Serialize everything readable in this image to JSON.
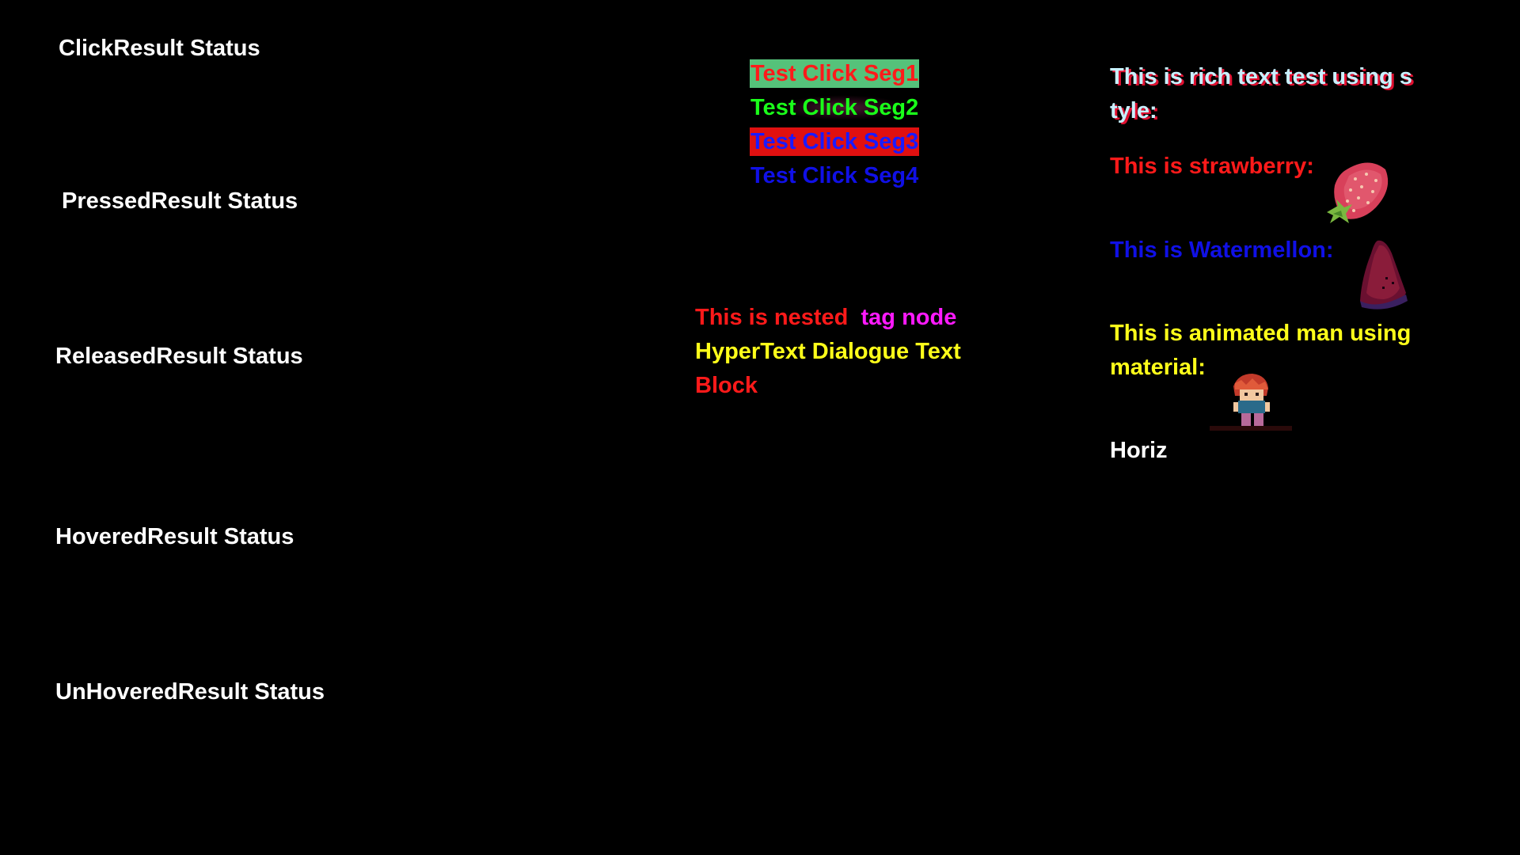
{
  "status": {
    "click": "ClickResult Status",
    "pressed": "PressedResult Status",
    "released": "ReleasedResult Status",
    "hovered": "HoveredResult Status",
    "unhovered": "UnHoveredResult Status"
  },
  "segments": [
    {
      "label": "Test Click Seg1",
      "color": "#ff1a1a",
      "background": "#55c27a"
    },
    {
      "label": "Test Click Seg2",
      "color": "#1aff1a",
      "background": ""
    },
    {
      "label": "Test Click Seg3",
      "color": "#1a1aff",
      "background": "#e01010"
    },
    {
      "label": "Test Click Seg4",
      "color": "#1010e6",
      "background": ""
    }
  ],
  "nested": {
    "part1": "This is nested",
    "part2": "tag node",
    "line2": "HyperText Dialogue Text",
    "line3": "Block",
    "colors": {
      "red": "#ff1a1a",
      "magenta": "#ff1aff",
      "yellow": "#ffff1a"
    }
  },
  "rich": {
    "title_line1": "This is rich text test using s",
    "title_line2": "tyle:",
    "strawberry": "This is strawberry:",
    "watermelon": "This is Watermellon:",
    "man_line1": "This is animated man using",
    "man_line2": "material:",
    "horiz": "Horiz",
    "colors": {
      "strawberry": "#ff1a1a",
      "watermelon": "#1010e6",
      "man": "#ffff1a",
      "title": "#c8f0ff",
      "title_shadow": "#e01030"
    }
  },
  "icons": [
    "strawberry-icon",
    "watermelon-icon",
    "animated-man-icon"
  ]
}
